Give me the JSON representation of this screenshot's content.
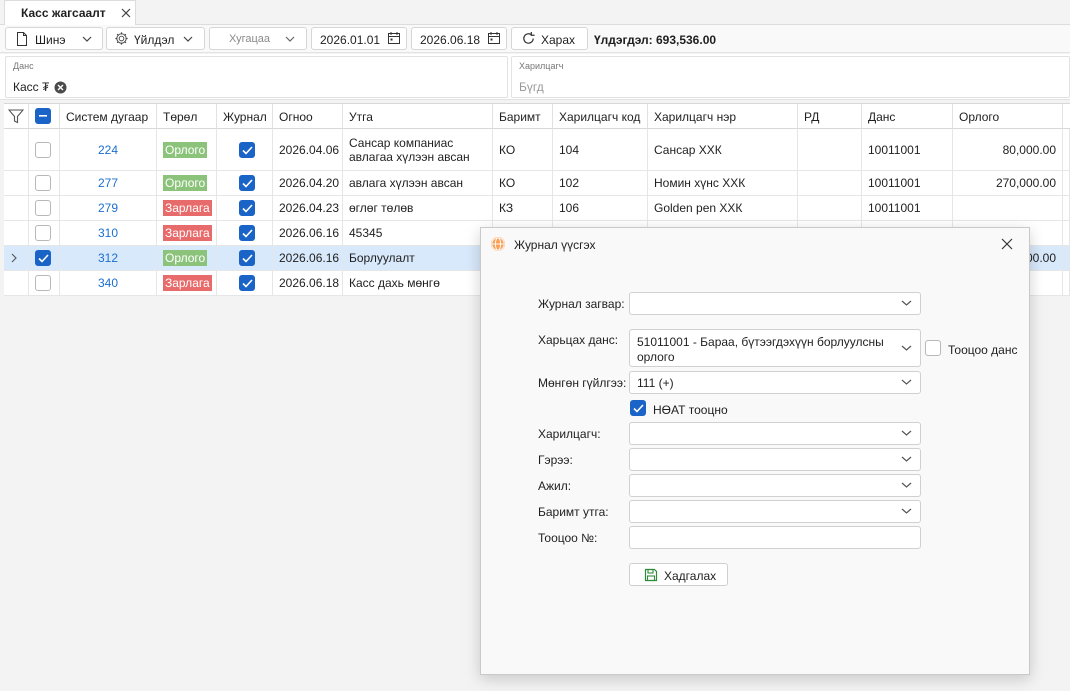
{
  "tab": {
    "title": "Касс жагсаалт"
  },
  "toolbar": {
    "new_label": "Шинэ",
    "action_label": "Үйлдэл",
    "period_placeholder": "Хугацаа",
    "date_from": "2026.01.01",
    "date_to": "2026.06.18",
    "view_label": "Харах",
    "balance": "Үлдэгдэл: 693,536.00"
  },
  "filters": {
    "account_caption": "Данс",
    "account_value": "Касс ₮",
    "partner_caption": "Харилцагч",
    "partner_value": "Бүгд"
  },
  "grid": {
    "columns": [
      "Систем дугаар",
      "Төрөл",
      "Журнал",
      "Огноо",
      "Утга",
      "Баримт",
      "Харилцагч код",
      "Харилцагч нэр",
      "РД",
      "Данс",
      "Орлого"
    ],
    "rows": [
      {
        "id": "224",
        "type": "Орлого",
        "date": "2026.04.06",
        "desc1": "Сансар компаниас",
        "desc2": "авлагаа хүлээн авсан",
        "doc": "КО",
        "pcode": "104",
        "pname": "Сансар ХХК",
        "rd": "",
        "account": "10011001",
        "income": "80,000.00"
      },
      {
        "id": "277",
        "type": "Орлого",
        "date": "2026.04.20",
        "desc1": "авлага хүлээн авсан",
        "desc2": "",
        "doc": "КО",
        "pcode": "102",
        "pname": "Номин хүнс ХХК",
        "rd": "",
        "account": "10011001",
        "income": "270,000.00"
      },
      {
        "id": "279",
        "type": "Зарлага",
        "date": "2026.04.23",
        "desc1": "өглөг төлөв",
        "desc2": "",
        "doc": "КЗ",
        "pcode": "106",
        "pname": "Golden pen ХХК",
        "rd": "",
        "account": "10011001",
        "income": ""
      },
      {
        "id": "310",
        "type": "Зарлага",
        "date": "2026.06.16",
        "desc1": "45345",
        "desc2": "",
        "doc": "",
        "pcode": "",
        "pname": "",
        "rd": "",
        "account": "",
        "income": ""
      },
      {
        "id": "312",
        "type": "Орлого",
        "date": "2026.06.16",
        "desc1": "Борлуулалт",
        "desc2": "",
        "doc": "",
        "pcode": "",
        "pname": "",
        "rd": "",
        "account": "",
        "income": "00.00"
      },
      {
        "id": "340",
        "type": "Зарлага",
        "date": "2026.06.18",
        "desc1": "Касс дахь мөнгө",
        "desc2": "",
        "doc": "",
        "pcode": "",
        "pname": "",
        "rd": "",
        "account": "",
        "income": ""
      }
    ]
  },
  "dialog": {
    "title": "Журнал үүсгэх",
    "template_label": "Журнал загвар:",
    "template_value": "",
    "contra_label": "Харьцах данс:",
    "contra_value_1": "51011001 - Бараа, бүтээгдэхүүн борлуулсны",
    "contra_value_2": "орлого",
    "settlement_label": "Тооцоо данс",
    "cashflow_label": "Мөнгөн гүйлгээ:",
    "cashflow_value": "111 (+)",
    "vat_label": "НӨАТ тооцно",
    "partner_label": "Харилцагч:",
    "contract_label": "Гэрээ:",
    "job_label": "Ажил:",
    "docmeaning_label": "Баримт утга:",
    "settlement_no_label": "Тооцоо №:",
    "save_label": "Хадгалах"
  },
  "colors": {
    "accent": "#1a63c7",
    "income": "#8cc37a",
    "expense": "#e86b6b",
    "link": "#1c6fd1",
    "selected": "#d8e9fb"
  }
}
